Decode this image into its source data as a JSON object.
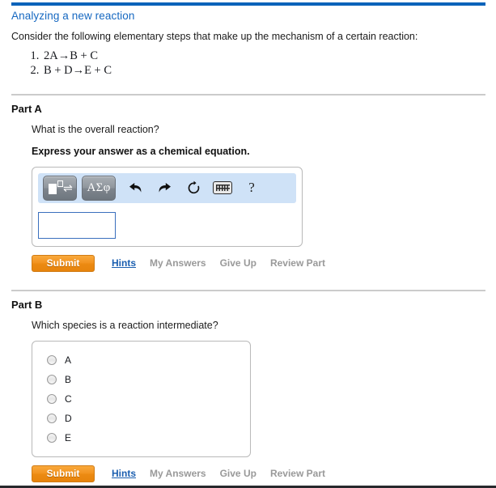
{
  "header": {
    "title": "Analyzing a new reaction",
    "accent_color": "#0b63ba",
    "title_color": "#1668c1"
  },
  "intro": {
    "text": "Consider the following elementary steps that make up the mechanism of a certain reaction:"
  },
  "mechanism_steps": [
    {
      "number": "1.",
      "equation": "2A→B + C"
    },
    {
      "number": "2.",
      "equation": "B + D→E + C"
    }
  ],
  "part_a": {
    "heading": "Part A",
    "question": "What is the overall reaction?",
    "instruction": "Express your answer as a chemical equation.",
    "answer_input": {
      "value": "",
      "placeholder": ""
    },
    "math_toolbar": {
      "buttons": [
        {
          "name": "template-equilibrium-button",
          "label": ""
        },
        {
          "name": "greek-symbols-button",
          "label": "ΑΣφ"
        }
      ],
      "icons": [
        {
          "name": "undo-icon",
          "glyph": "⮜"
        },
        {
          "name": "redo-icon",
          "glyph": "⮞"
        },
        {
          "name": "reset-icon",
          "glyph": "↻"
        },
        {
          "name": "keyboard-icon",
          "glyph": ""
        },
        {
          "name": "help-icon",
          "glyph": "?"
        }
      ],
      "background_color": "#cfe2f7"
    },
    "actions": {
      "submit": "Submit",
      "hints": "Hints",
      "my_answers": "My Answers",
      "give_up": "Give Up",
      "review_part": "Review Part"
    }
  },
  "part_b": {
    "heading": "Part B",
    "question": "Which species is a reaction intermediate?",
    "choices": [
      {
        "label": "A",
        "selected": false
      },
      {
        "label": "B",
        "selected": false
      },
      {
        "label": "C",
        "selected": false
      },
      {
        "label": "D",
        "selected": false
      },
      {
        "label": "E",
        "selected": false
      }
    ],
    "actions": {
      "submit": "Submit",
      "hints": "Hints",
      "my_answers": "My Answers",
      "give_up": "Give Up",
      "review_part": "Review Part"
    }
  },
  "colors": {
    "submit_orange": "#ef8f1c",
    "link_blue": "#1b5fb0",
    "muted_gray": "#999999",
    "divider_gray": "#cbcbcb",
    "input_border_blue": "#3a6fbd"
  }
}
